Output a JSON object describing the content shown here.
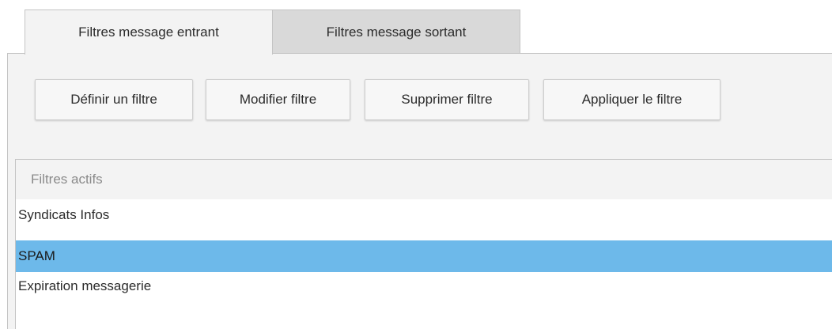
{
  "tabs": [
    {
      "label": "Filtres message entrant",
      "active": true
    },
    {
      "label": "Filtres message sortant",
      "active": false
    }
  ],
  "toolbar": {
    "define_label": "Définir un filtre",
    "modify_label": "Modifier filtre",
    "delete_label": "Supprimer filtre",
    "apply_label": "Appliquer le filtre"
  },
  "filters": {
    "header": "Filtres actifs",
    "items": [
      {
        "label": "Syndicats Infos",
        "selected": false
      },
      {
        "label": "SPAM",
        "selected": true
      },
      {
        "label": "Expiration messagerie",
        "selected": false
      }
    ]
  },
  "colors": {
    "selection": "#6db9ea",
    "panel_background": "#f3f3f3",
    "inactive_tab": "#d9d9d9"
  }
}
